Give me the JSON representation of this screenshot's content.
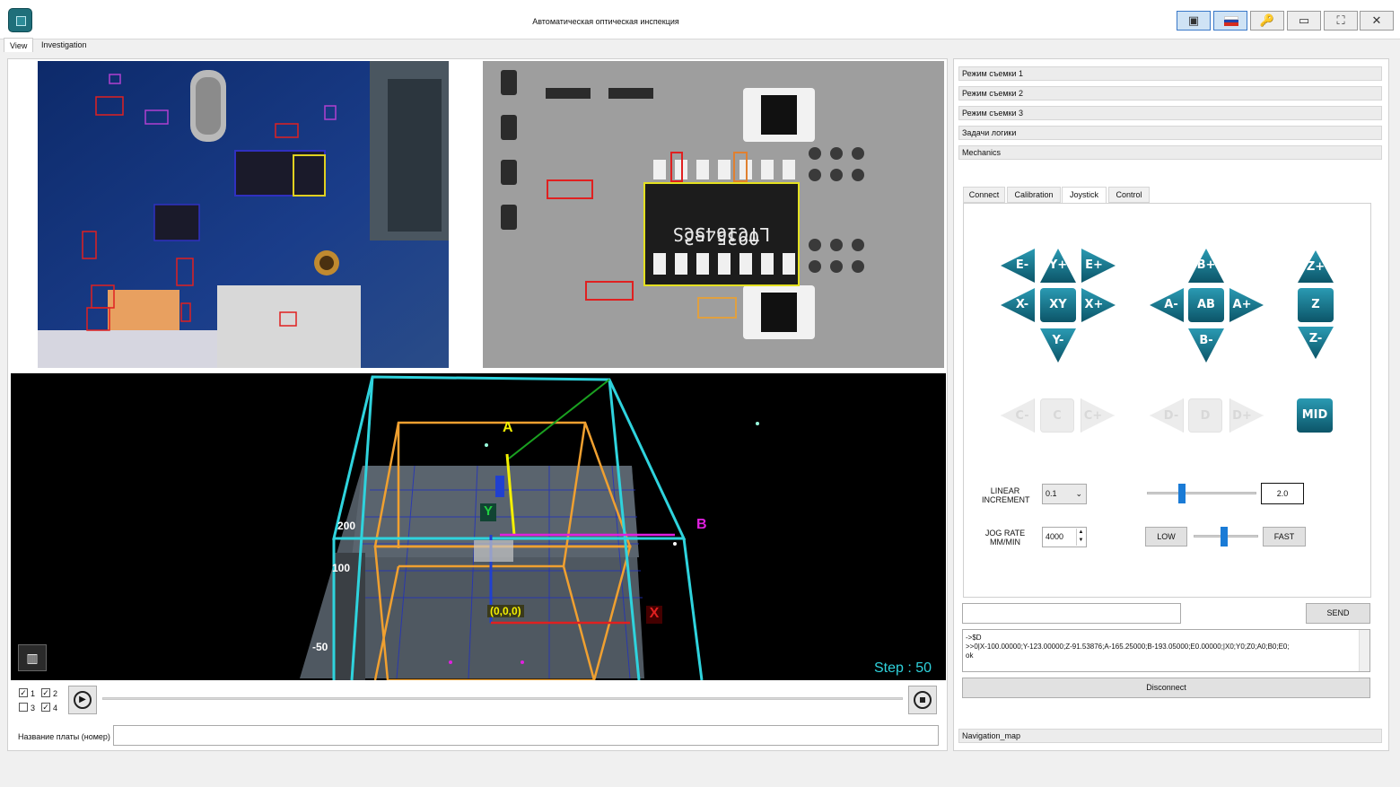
{
  "window": {
    "title": "Автоматическая оптическая инспекция"
  },
  "menu_tabs": {
    "view": "View",
    "investigation": "Investigation"
  },
  "accordion": {
    "mode1": "Режим съемки 1",
    "mode2": "Режим съемки 2",
    "mode3": "Режим съемки 3",
    "logic": "Задачи логики",
    "mechanics": "Mechanics",
    "navigation": "Navigation_map"
  },
  "control_tabs": {
    "connect": "Connect",
    "calibration": "Calibration",
    "joystick": "Joystick",
    "control": "Control"
  },
  "joystick": {
    "e_minus": "E-",
    "e_plus": "E+",
    "y_plus": "Y+",
    "y_minus": "Y-",
    "x_minus": "X-",
    "x_plus": "X+",
    "xy": "XY",
    "b_plus": "B+",
    "b_minus": "B-",
    "a_minus": "A-",
    "a_plus": "A+",
    "ab": "AB",
    "z_plus": "Z+",
    "z": "Z",
    "z_minus": "Z-",
    "c_minus": "C-",
    "c": "C",
    "c_plus": "C+",
    "d_minus": "D-",
    "d": "D",
    "d_plus": "D+",
    "mid": "MID"
  },
  "settings": {
    "linear_increment_label": "LINEAR INCREMENT",
    "linear_increment_value": "0.1",
    "slider_value": "2.0",
    "jog_rate_label": "JOG RATE MM/MIN",
    "jog_rate_value": "4000",
    "low": "LOW",
    "fast": "FAST",
    "linear_slider_level": 0.3,
    "jog_slider_level": 0.45
  },
  "console": {
    "send": "SEND",
    "line1": "->$D",
    "line2": ">>0|X-100.00000;Y-123.00000;Z-91.53876;A-165.25000;B-193.05000;E0.00000;|X0;Y0;Z0;A0;B0;E0;",
    "line3": "ok",
    "disconnect": "Disconnect"
  },
  "viewer3d": {
    "step": "Step : 50",
    "axis_a": "A",
    "axis_b": "B",
    "axis_x": "X",
    "axis_y": "Y",
    "origin": "(0,0,0)",
    "tick_200": "200",
    "tick_100": "100",
    "tick_50": "-50"
  },
  "playback": {
    "cb1": "1",
    "cb2": "2",
    "cb3": "3",
    "cb4": "4"
  },
  "board": {
    "label": "Название платы (номер)",
    "value": ""
  },
  "colors": {
    "accent": "#1f8aa3",
    "cyan_box": "#2fd3dd",
    "orange_box": "#f0a030",
    "yellow": "#f4f000",
    "magenta": "#e020e0"
  }
}
